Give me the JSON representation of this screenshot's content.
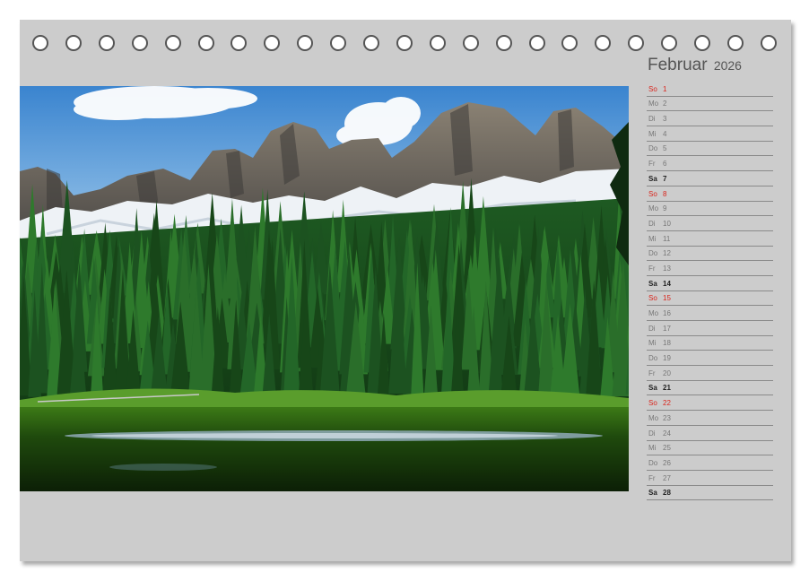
{
  "calendar": {
    "month": "Februar",
    "year": "2026",
    "ring_count": 23,
    "days": [
      {
        "name": "So",
        "num": "1",
        "type": "sun"
      },
      {
        "name": "Mo",
        "num": "2",
        "type": "week"
      },
      {
        "name": "Di",
        "num": "3",
        "type": "week"
      },
      {
        "name": "Mi",
        "num": "4",
        "type": "week"
      },
      {
        "name": "Do",
        "num": "5",
        "type": "week"
      },
      {
        "name": "Fr",
        "num": "6",
        "type": "week"
      },
      {
        "name": "Sa",
        "num": "7",
        "type": "sat"
      },
      {
        "name": "So",
        "num": "8",
        "type": "sun"
      },
      {
        "name": "Mo",
        "num": "9",
        "type": "week"
      },
      {
        "name": "Di",
        "num": "10",
        "type": "week"
      },
      {
        "name": "Mi",
        "num": "11",
        "type": "week"
      },
      {
        "name": "Do",
        "num": "12",
        "type": "week"
      },
      {
        "name": "Fr",
        "num": "13",
        "type": "week"
      },
      {
        "name": "Sa",
        "num": "14",
        "type": "sat"
      },
      {
        "name": "So",
        "num": "15",
        "type": "sun"
      },
      {
        "name": "Mo",
        "num": "16",
        "type": "week"
      },
      {
        "name": "Di",
        "num": "17",
        "type": "week"
      },
      {
        "name": "Mi",
        "num": "18",
        "type": "week"
      },
      {
        "name": "Do",
        "num": "19",
        "type": "week"
      },
      {
        "name": "Fr",
        "num": "20",
        "type": "week"
      },
      {
        "name": "Sa",
        "num": "21",
        "type": "sat"
      },
      {
        "name": "So",
        "num": "22",
        "type": "sun"
      },
      {
        "name": "Mo",
        "num": "23",
        "type": "week"
      },
      {
        "name": "Di",
        "num": "24",
        "type": "week"
      },
      {
        "name": "Mi",
        "num": "25",
        "type": "week"
      },
      {
        "name": "Do",
        "num": "26",
        "type": "week"
      },
      {
        "name": "Fr",
        "num": "27",
        "type": "week"
      },
      {
        "name": "Sa",
        "num": "28",
        "type": "sat"
      }
    ]
  },
  "colors": {
    "page": "#cccccc",
    "sunday": "#d9251c",
    "saturday": "#222222",
    "weekday": "#777777"
  }
}
